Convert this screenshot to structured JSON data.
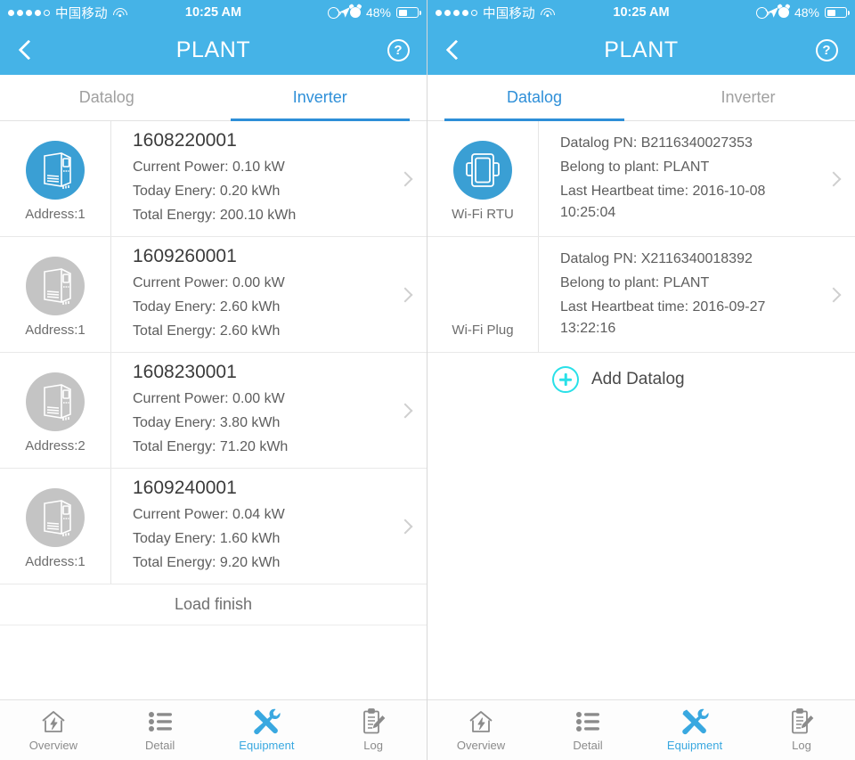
{
  "statusbar": {
    "carrier": "中国移动",
    "time": "10:25 AM",
    "battery_percent": "48%",
    "signal_dots_filled": 4,
    "signal_dots_total": 5,
    "icons": [
      "wifi-icon",
      "rotation-lock-icon",
      "location-arrow-icon",
      "alarm-clock-icon",
      "battery-icon"
    ]
  },
  "navbar": {
    "title": "PLANT",
    "back_icon": "chevron-left-icon",
    "help_icon": "help-circle-icon",
    "help_label": "?"
  },
  "colors": {
    "brand_blue": "#45b3e7",
    "accent_blue": "#2e8fd8",
    "icon_blue": "#3a9fd4",
    "icon_gray": "#c4c4c4",
    "add_cyan": "#29e0e8",
    "text_dark": "#3b3b3b",
    "text_muted": "#5d5d5d",
    "tab_inactive": "#a0a0a0"
  },
  "left_screen": {
    "tabs": [
      {
        "label": "Datalog",
        "active": false
      },
      {
        "label": "Inverter",
        "active": true
      }
    ],
    "inverters": [
      {
        "serial": "1608220001",
        "current_power": "Current Power: 0.10 kW",
        "today_energy": "Today Enery: 0.20 kWh",
        "total_energy": "Total Energy: 200.10 kWh",
        "address": "Address:1",
        "icon": "inverter-icon",
        "state": "online"
      },
      {
        "serial": "1609260001",
        "current_power": "Current Power: 0.00 kW",
        "today_energy": "Today Enery: 2.60 kWh",
        "total_energy": "Total Energy: 2.60 kWh",
        "address": "Address:1",
        "icon": "inverter-icon",
        "state": "offline"
      },
      {
        "serial": "1608230001",
        "current_power": "Current Power: 0.00 kW",
        "today_energy": "Today Enery: 3.80 kWh",
        "total_energy": "Total Energy: 71.20 kWh",
        "address": "Address:2",
        "icon": "inverter-icon",
        "state": "offline"
      },
      {
        "serial": "1609240001",
        "current_power": "Current Power: 0.04 kW",
        "today_energy": "Today Enery: 1.60 kWh",
        "total_energy": "Total Energy: 9.20 kWh",
        "address": "Address:1",
        "icon": "inverter-icon",
        "state": "offline"
      }
    ],
    "footer_status": "Load finish"
  },
  "right_screen": {
    "tabs": [
      {
        "label": "Datalog",
        "active": true
      },
      {
        "label": "Inverter",
        "active": false
      }
    ],
    "dataloggers": [
      {
        "pn": "Datalog PN: B2116340027353",
        "plant": "Belong to plant: PLANT",
        "heartbeat": "Last Heartbeat time: 2016-10-08 10:25:04",
        "device_label": "Wi-Fi RTU",
        "icon": "wifi-rtu-icon",
        "state": "online"
      },
      {
        "pn": "Datalog PN: X2116340018392",
        "plant": "Belong to plant: PLANT",
        "heartbeat": "Last Heartbeat time: 2016-09-27 13:22:16",
        "device_label": "Wi-Fi Plug",
        "icon": "none",
        "state": "offline"
      }
    ],
    "add_datalog_label": "Add Datalog",
    "add_icon": "plus-circle-icon"
  },
  "tabbar": [
    {
      "label": "Overview",
      "icon": "home-overview-icon",
      "active": false
    },
    {
      "label": "Detail",
      "icon": "list-detail-icon",
      "active": false
    },
    {
      "label": "Equipment",
      "icon": "tools-equipment-icon",
      "active": true
    },
    {
      "label": "Log",
      "icon": "clipboard-log-icon",
      "active": false
    }
  ]
}
